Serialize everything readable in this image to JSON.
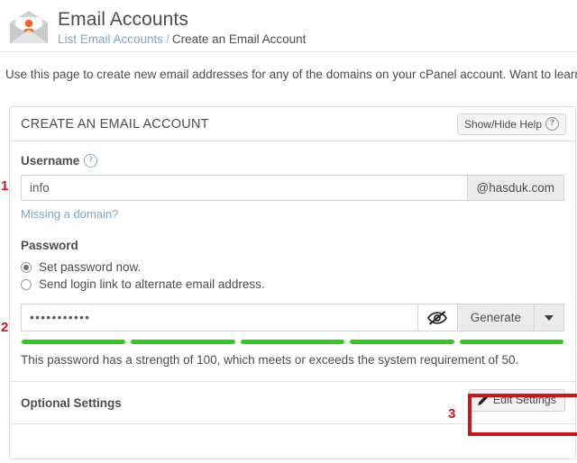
{
  "header": {
    "title": "Email Accounts",
    "icon": "email-account-icon",
    "breadcrumb": {
      "link_label": "List Email Accounts",
      "separator": "/",
      "current": "Create an Email Account"
    }
  },
  "intro": {
    "text": "Use this page to create new email addresses for any of the domains on your cPanel account. Want to learn m"
  },
  "panel": {
    "title": "CREATE AN EMAIL ACCOUNT",
    "help_toggle": {
      "label": "Show/Hide Help",
      "icon": "question-circle-icon"
    },
    "username": {
      "label": "Username",
      "help_icon": "question-circle-icon",
      "value": "info",
      "placeholder": "",
      "domain_addon": "@hasduk.com",
      "missing_domain_link": "Missing a domain?"
    },
    "password": {
      "label": "Password",
      "options": [
        {
          "label": "Set password now.",
          "selected": true
        },
        {
          "label": "Send login link to alternate email address.",
          "selected": false
        }
      ],
      "value": "•••••••••••",
      "placeholder": "",
      "toggle_visibility_icon": "eye-slash-icon",
      "generate_label": "Generate",
      "generate_caret_icon": "chevron-down-icon",
      "strength_segments": 5,
      "strength_color": "#2fcc1f",
      "strength_note": "This password has a strength of 100, which meets or exceeds the system requirement of 50."
    },
    "optional_settings": {
      "title": "Optional Settings",
      "edit_button": {
        "label": "Edit Settings",
        "icon": "pencil-icon"
      }
    }
  },
  "annotations": {
    "markers": [
      {
        "label": "1",
        "target": "username-input"
      },
      {
        "label": "2",
        "target": "password-input"
      },
      {
        "label": "3",
        "target": "edit-settings-button"
      }
    ],
    "highlight_color": "#c9151b"
  },
  "colors": {
    "link": "#7ba7cc",
    "text": "#4d4d4d",
    "accent_orange": "#f0662a",
    "strength_green": "#2fcc1f",
    "annotation_red": "#c9151b"
  }
}
